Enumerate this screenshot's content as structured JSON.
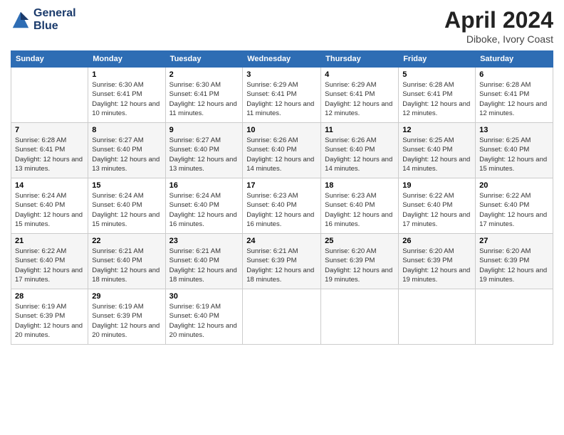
{
  "header": {
    "logo_line1": "General",
    "logo_line2": "Blue",
    "month_title": "April 2024",
    "location": "Diboke, Ivory Coast"
  },
  "days_of_week": [
    "Sunday",
    "Monday",
    "Tuesday",
    "Wednesday",
    "Thursday",
    "Friday",
    "Saturday"
  ],
  "weeks": [
    [
      {
        "day": "",
        "sunrise": "",
        "sunset": "",
        "daylight": ""
      },
      {
        "day": "1",
        "sunrise": "Sunrise: 6:30 AM",
        "sunset": "Sunset: 6:41 PM",
        "daylight": "Daylight: 12 hours and 10 minutes."
      },
      {
        "day": "2",
        "sunrise": "Sunrise: 6:30 AM",
        "sunset": "Sunset: 6:41 PM",
        "daylight": "Daylight: 12 hours and 11 minutes."
      },
      {
        "day": "3",
        "sunrise": "Sunrise: 6:29 AM",
        "sunset": "Sunset: 6:41 PM",
        "daylight": "Daylight: 12 hours and 11 minutes."
      },
      {
        "day": "4",
        "sunrise": "Sunrise: 6:29 AM",
        "sunset": "Sunset: 6:41 PM",
        "daylight": "Daylight: 12 hours and 12 minutes."
      },
      {
        "day": "5",
        "sunrise": "Sunrise: 6:28 AM",
        "sunset": "Sunset: 6:41 PM",
        "daylight": "Daylight: 12 hours and 12 minutes."
      },
      {
        "day": "6",
        "sunrise": "Sunrise: 6:28 AM",
        "sunset": "Sunset: 6:41 PM",
        "daylight": "Daylight: 12 hours and 12 minutes."
      }
    ],
    [
      {
        "day": "7",
        "sunrise": "Sunrise: 6:28 AM",
        "sunset": "Sunset: 6:41 PM",
        "daylight": "Daylight: 12 hours and 13 minutes."
      },
      {
        "day": "8",
        "sunrise": "Sunrise: 6:27 AM",
        "sunset": "Sunset: 6:40 PM",
        "daylight": "Daylight: 12 hours and 13 minutes."
      },
      {
        "day": "9",
        "sunrise": "Sunrise: 6:27 AM",
        "sunset": "Sunset: 6:40 PM",
        "daylight": "Daylight: 12 hours and 13 minutes."
      },
      {
        "day": "10",
        "sunrise": "Sunrise: 6:26 AM",
        "sunset": "Sunset: 6:40 PM",
        "daylight": "Daylight: 12 hours and 14 minutes."
      },
      {
        "day": "11",
        "sunrise": "Sunrise: 6:26 AM",
        "sunset": "Sunset: 6:40 PM",
        "daylight": "Daylight: 12 hours and 14 minutes."
      },
      {
        "day": "12",
        "sunrise": "Sunrise: 6:25 AM",
        "sunset": "Sunset: 6:40 PM",
        "daylight": "Daylight: 12 hours and 14 minutes."
      },
      {
        "day": "13",
        "sunrise": "Sunrise: 6:25 AM",
        "sunset": "Sunset: 6:40 PM",
        "daylight": "Daylight: 12 hours and 15 minutes."
      }
    ],
    [
      {
        "day": "14",
        "sunrise": "Sunrise: 6:24 AM",
        "sunset": "Sunset: 6:40 PM",
        "daylight": "Daylight: 12 hours and 15 minutes."
      },
      {
        "day": "15",
        "sunrise": "Sunrise: 6:24 AM",
        "sunset": "Sunset: 6:40 PM",
        "daylight": "Daylight: 12 hours and 15 minutes."
      },
      {
        "day": "16",
        "sunrise": "Sunrise: 6:24 AM",
        "sunset": "Sunset: 6:40 PM",
        "daylight": "Daylight: 12 hours and 16 minutes."
      },
      {
        "day": "17",
        "sunrise": "Sunrise: 6:23 AM",
        "sunset": "Sunset: 6:40 PM",
        "daylight": "Daylight: 12 hours and 16 minutes."
      },
      {
        "day": "18",
        "sunrise": "Sunrise: 6:23 AM",
        "sunset": "Sunset: 6:40 PM",
        "daylight": "Daylight: 12 hours and 16 minutes."
      },
      {
        "day": "19",
        "sunrise": "Sunrise: 6:22 AM",
        "sunset": "Sunset: 6:40 PM",
        "daylight": "Daylight: 12 hours and 17 minutes."
      },
      {
        "day": "20",
        "sunrise": "Sunrise: 6:22 AM",
        "sunset": "Sunset: 6:40 PM",
        "daylight": "Daylight: 12 hours and 17 minutes."
      }
    ],
    [
      {
        "day": "21",
        "sunrise": "Sunrise: 6:22 AM",
        "sunset": "Sunset: 6:40 PM",
        "daylight": "Daylight: 12 hours and 17 minutes."
      },
      {
        "day": "22",
        "sunrise": "Sunrise: 6:21 AM",
        "sunset": "Sunset: 6:40 PM",
        "daylight": "Daylight: 12 hours and 18 minutes."
      },
      {
        "day": "23",
        "sunrise": "Sunrise: 6:21 AM",
        "sunset": "Sunset: 6:40 PM",
        "daylight": "Daylight: 12 hours and 18 minutes."
      },
      {
        "day": "24",
        "sunrise": "Sunrise: 6:21 AM",
        "sunset": "Sunset: 6:39 PM",
        "daylight": "Daylight: 12 hours and 18 minutes."
      },
      {
        "day": "25",
        "sunrise": "Sunrise: 6:20 AM",
        "sunset": "Sunset: 6:39 PM",
        "daylight": "Daylight: 12 hours and 19 minutes."
      },
      {
        "day": "26",
        "sunrise": "Sunrise: 6:20 AM",
        "sunset": "Sunset: 6:39 PM",
        "daylight": "Daylight: 12 hours and 19 minutes."
      },
      {
        "day": "27",
        "sunrise": "Sunrise: 6:20 AM",
        "sunset": "Sunset: 6:39 PM",
        "daylight": "Daylight: 12 hours and 19 minutes."
      }
    ],
    [
      {
        "day": "28",
        "sunrise": "Sunrise: 6:19 AM",
        "sunset": "Sunset: 6:39 PM",
        "daylight": "Daylight: 12 hours and 20 minutes."
      },
      {
        "day": "29",
        "sunrise": "Sunrise: 6:19 AM",
        "sunset": "Sunset: 6:39 PM",
        "daylight": "Daylight: 12 hours and 20 minutes."
      },
      {
        "day": "30",
        "sunrise": "Sunrise: 6:19 AM",
        "sunset": "Sunset: 6:40 PM",
        "daylight": "Daylight: 12 hours and 20 minutes."
      },
      {
        "day": "",
        "sunrise": "",
        "sunset": "",
        "daylight": ""
      },
      {
        "day": "",
        "sunrise": "",
        "sunset": "",
        "daylight": ""
      },
      {
        "day": "",
        "sunrise": "",
        "sunset": "",
        "daylight": ""
      },
      {
        "day": "",
        "sunrise": "",
        "sunset": "",
        "daylight": ""
      }
    ]
  ]
}
